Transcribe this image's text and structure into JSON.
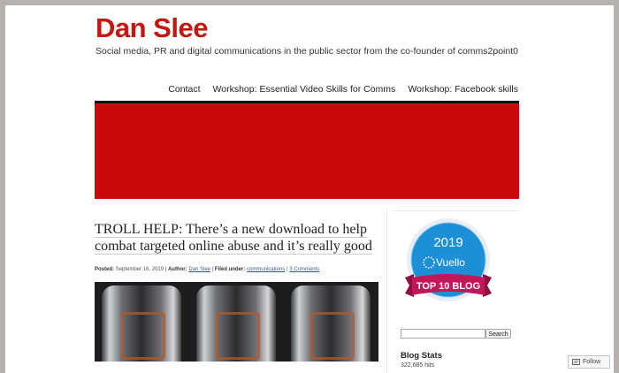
{
  "site": {
    "title": "Dan Slee",
    "tagline": "Social media, PR and digital communications in the public sector from the co-founder of comms2point0"
  },
  "nav": {
    "items": [
      "Contact",
      "Workshop: Essential Video Skills for Comms",
      "Workshop: Facebook skills"
    ]
  },
  "colors": {
    "brand_red": "#c3170f",
    "banner_red": "#c80a0a",
    "badge_blue": "#1d8fd6",
    "ribbon_magenta": "#c2185b"
  },
  "post": {
    "title": "TROLL HELP: There’s a new download to help combat targeted online abuse and it’s really good",
    "meta": {
      "posted_label": "Posted:",
      "date": "September 16, 2019",
      "author_label": "Author:",
      "author": "Dan Slee",
      "filed_label": "Filed under:",
      "category": "communications",
      "comments": "3 Comments",
      "sep": " | "
    }
  },
  "sidebar": {
    "badge": {
      "year": "2019",
      "brand": "Vuello",
      "ribbon": "TOP 10 BLOG"
    },
    "search": {
      "value": "",
      "button": "Search"
    },
    "stats": {
      "title": "Blog Stats",
      "hits": "322,685 hits"
    }
  },
  "follow": {
    "label": "Follow",
    "icon": "follow-icon"
  }
}
